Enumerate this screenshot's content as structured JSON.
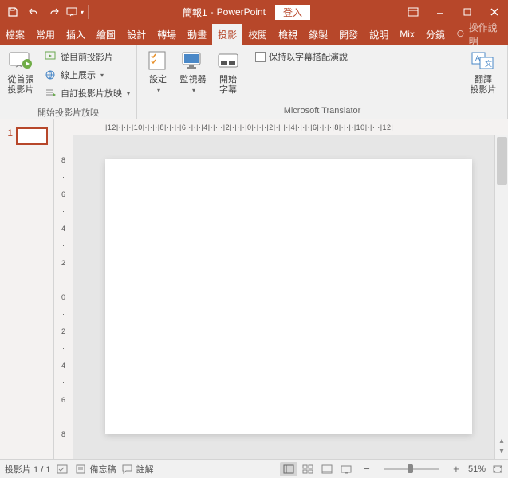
{
  "title": {
    "doc": "簡報1",
    "app": "PowerPoint",
    "login": "登入"
  },
  "tabs": [
    "檔案",
    "常用",
    "插入",
    "繪圖",
    "設計",
    "轉場",
    "動畫",
    "投影片放映",
    "校閱",
    "檢視",
    "錄製",
    "開發人員",
    "說明",
    "Mix",
    "分鏡腳本"
  ],
  "active_tab_index": 7,
  "tell_me": "操作說明",
  "ribbon": {
    "group1": {
      "label": "開始投影片放映",
      "big": "從首張\n投影片",
      "small": [
        "從目前投影片",
        "線上展示",
        "自訂投影片放映"
      ]
    },
    "group2": {
      "settings": "設定",
      "monitors": "監視器",
      "subtitles": "開始\n字幕",
      "checkbox": "保持以字幕搭配演說"
    },
    "group3": {
      "label": "Microsoft Translator",
      "translate": "翻譯\n投影片"
    }
  },
  "thumb": {
    "num": "1"
  },
  "ruler_h": "|12|·|·|·|10|·|·|·|8|·|·|·|6|·|·|·|4|·|·|·|2|·|·|·|0|·|·|·|2|·|·|·|4|·|·|·|6|·|·|·|8|·|·|·|10|·|·|·|12|",
  "ruler_v": [
    "8",
    "6",
    "4",
    "2",
    "0",
    "2",
    "4",
    "6",
    "8"
  ],
  "status": {
    "slide": "投影片 1 / 1",
    "notes": "備忘稿",
    "comments": "註解",
    "zoom": "51%"
  }
}
